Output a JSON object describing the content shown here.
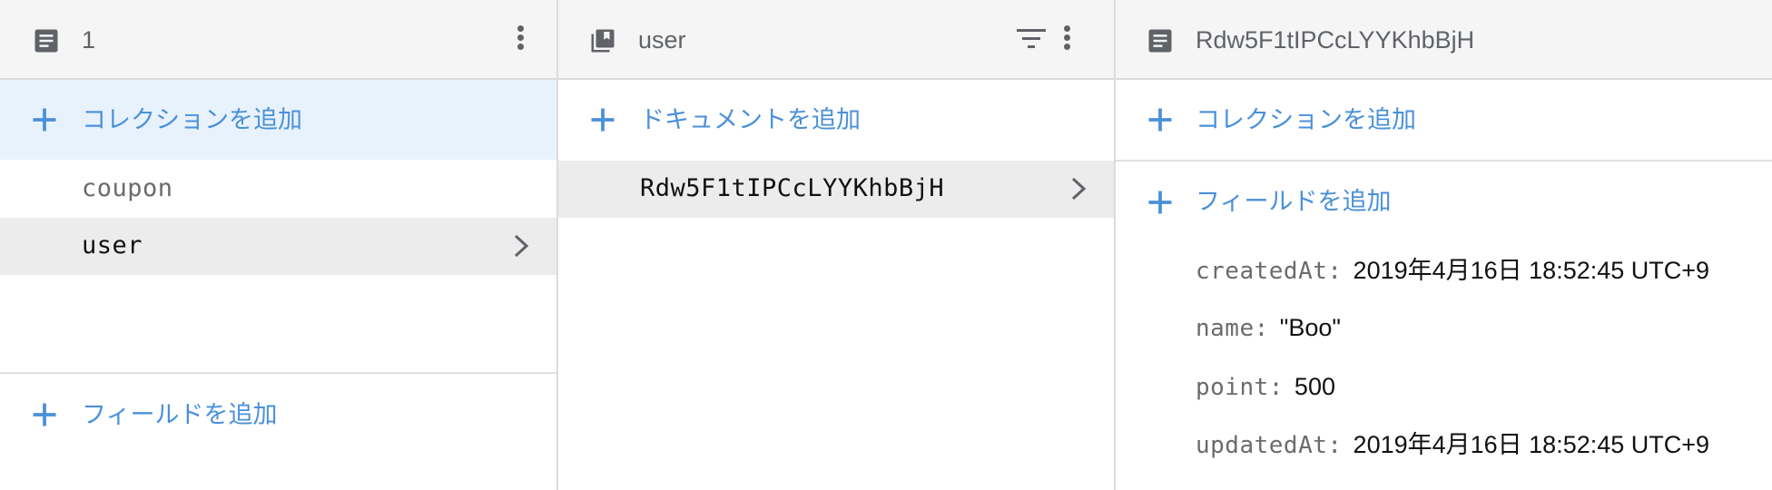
{
  "accent_color": "#4a90d9",
  "panel1": {
    "header_icon": "document-icon",
    "header_title": "1",
    "add_collection_label": "コレクションを追加",
    "collections": [
      {
        "label": "coupon",
        "selected": false
      },
      {
        "label": "user",
        "selected": true
      }
    ],
    "add_field_label": "フィールドを追加"
  },
  "panel2": {
    "header_icon": "collection-icon",
    "header_title": "user",
    "add_document_label": "ドキュメントを追加",
    "documents": [
      {
        "label": "Rdw5F1tIPCcLYYKhbBjH",
        "selected": true
      }
    ]
  },
  "panel3": {
    "header_icon": "document-icon",
    "header_title": "Rdw5F1tIPCcLYYKhbBjH",
    "add_collection_label": "コレクションを追加",
    "add_field_label": "フィールドを追加",
    "fields": [
      {
        "key": "createdAt:",
        "value": "2019年4月16日 18:52:45 UTC+9"
      },
      {
        "key": "name:",
        "value": "\"Boo\""
      },
      {
        "key": "point:",
        "value": "500"
      },
      {
        "key": "updatedAt:",
        "value": "2019年4月16日 18:52:45 UTC+9"
      }
    ]
  }
}
